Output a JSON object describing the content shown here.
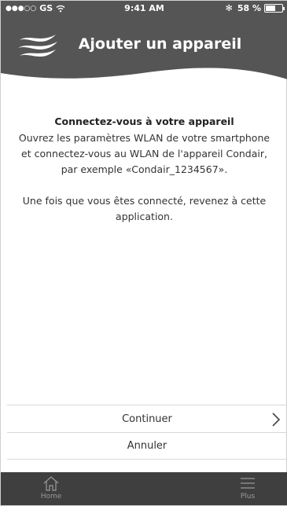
{
  "status_bar": {
    "signal_dots": "●●●○○",
    "carrier": "GS",
    "time": "9:41 AM",
    "bluetooth": "✻",
    "battery_text": "58 %",
    "battery_level": 0.58
  },
  "header": {
    "title": "Ajouter un appareil",
    "bg_color": "#555555"
  },
  "content": {
    "heading": "Connectez-vous à votre appareil",
    "paragraph1": "Ouvrez les paramètres WLAN de votre smartphone et connectez-vous au WLAN de l'appareil Condair, par exemple «Condair_1234567».",
    "paragraph2": "Une fois que vous êtes connecté, revenez à cette application."
  },
  "actions": {
    "continue_label": "Continuer",
    "cancel_label": "Annuler"
  },
  "tabbar": {
    "home_label": "Home",
    "more_label": "Plus",
    "bg_color": "#3f3f3f"
  }
}
